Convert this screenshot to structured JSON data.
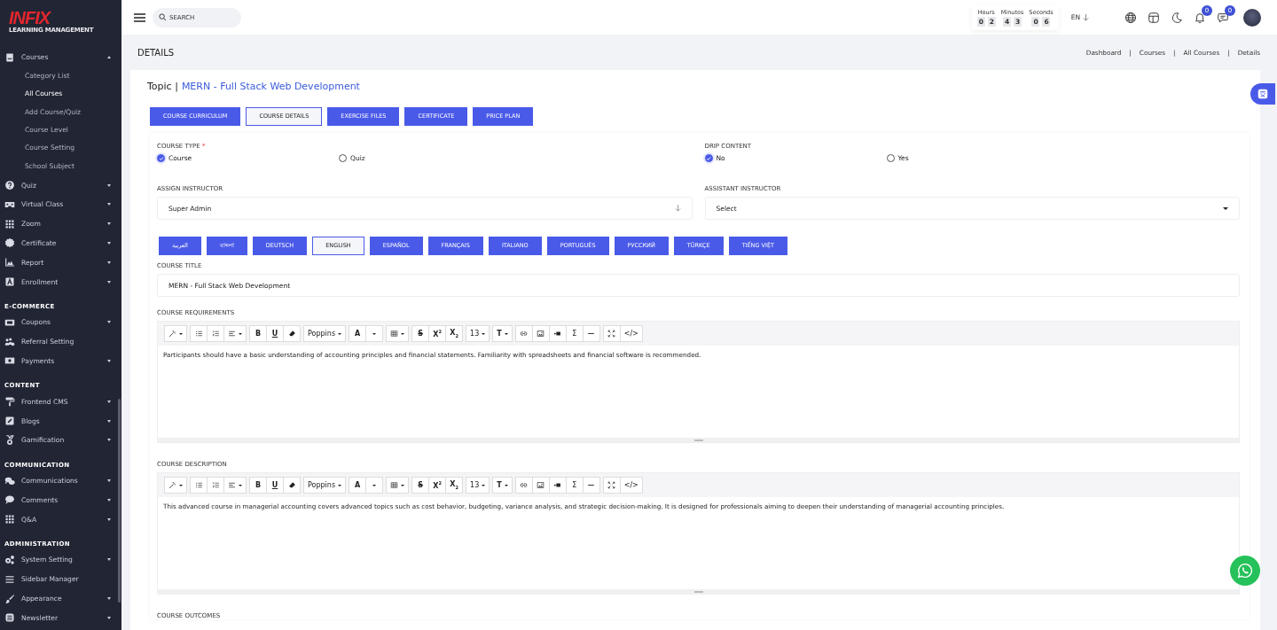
{
  "sidebar": {
    "logo": {
      "title": "INFIX",
      "subtitle": "LEARNING MANAGEMENT"
    },
    "sections": [
      {
        "items": [
          {
            "label": "Courses",
            "kind": "book",
            "expanded": true,
            "children": [
              {
                "label": "Category List",
                "selected": false
              },
              {
                "label": "All Courses",
                "selected": true
              },
              {
                "label": "Add Course/Quiz",
                "selected": false
              },
              {
                "label": "Course Level",
                "selected": false
              },
              {
                "label": "Course Setting",
                "selected": false
              },
              {
                "label": "School Subject",
                "selected": false
              }
            ]
          },
          {
            "label": "Quiz",
            "kind": "question",
            "expanded": false
          },
          {
            "label": "Virtual Class",
            "kind": "vr",
            "expanded": false
          },
          {
            "label": "Zoom",
            "kind": "grid",
            "expanded": false
          },
          {
            "label": "Certificate",
            "kind": "seal",
            "expanded": false
          },
          {
            "label": "Report",
            "kind": "chart",
            "expanded": false
          },
          {
            "label": "Enrollment",
            "kind": "letter",
            "expanded": false
          }
        ]
      },
      {
        "heading": "E-COMMERCE",
        "items": [
          {
            "label": "Coupons",
            "kind": "ticket",
            "expanded": false
          },
          {
            "label": "Referral Setting",
            "kind": "people"
          },
          {
            "label": "Payments",
            "kind": "money",
            "expanded": false
          }
        ]
      },
      {
        "heading": "CONTENT",
        "items": [
          {
            "label": "Frontend CMS",
            "kind": "roller",
            "expanded": false
          },
          {
            "label": "Blogs",
            "kind": "pencil",
            "expanded": false
          },
          {
            "label": "Gamification",
            "kind": "medal",
            "expanded": false
          }
        ]
      },
      {
        "heading": "COMMUNICATION",
        "items": [
          {
            "label": "Communications",
            "kind": "chats",
            "expanded": false
          },
          {
            "label": "Comments",
            "kind": "bubble",
            "expanded": false
          },
          {
            "label": "Q&A",
            "kind": "grid",
            "expanded": false
          }
        ]
      },
      {
        "heading": "ADMINISTRATION",
        "items": [
          {
            "label": "System Setting",
            "kind": "gears",
            "expanded": false
          },
          {
            "label": "Sidebar Manager",
            "kind": "lines"
          },
          {
            "label": "Appearance",
            "kind": "brush",
            "expanded": false
          },
          {
            "label": "Newsletter",
            "kind": "news",
            "expanded": false
          }
        ]
      }
    ]
  },
  "topbar": {
    "search": {
      "placeholder": "SEARCH"
    },
    "timer": [
      {
        "label": "Hours",
        "digits": [
          "0",
          "2"
        ]
      },
      {
        "label": "Minutes",
        "digits": [
          "4",
          "3"
        ]
      },
      {
        "label": "Seconds",
        "digits": [
          "0",
          "6"
        ]
      }
    ],
    "language": "EN",
    "icons": [
      {
        "kind": "globe"
      },
      {
        "kind": "layout"
      },
      {
        "kind": "moon"
      },
      {
        "kind": "bell",
        "badge": "0"
      },
      {
        "kind": "chat",
        "badge": "0"
      }
    ]
  },
  "header": {
    "title": "DETAILS",
    "separator": "|",
    "breadcrumbs": [
      "Dashboard",
      "Courses",
      "All Courses",
      "Details"
    ]
  },
  "topic": {
    "label": "Topic |",
    "value": "MERN - Full Stack Web Development"
  },
  "tabs": [
    {
      "label": "COURSE CURRICULUM",
      "selected": false
    },
    {
      "label": "COURSE DETAILS",
      "selected": true
    },
    {
      "label": "EXERCISE FILES",
      "selected": false
    },
    {
      "label": "CERTIFICATE",
      "selected": false
    },
    {
      "label": "PRICE PLAN",
      "selected": false
    }
  ],
  "form": {
    "course_type": {
      "label": "COURSE TYPE",
      "required_mark": "*",
      "options": [
        {
          "label": "Course",
          "selected": true
        },
        {
          "label": "Quiz",
          "selected": false
        }
      ]
    },
    "drip_content": {
      "label": "DRIP CONTENT",
      "options": [
        {
          "label": "No",
          "selected": true
        },
        {
          "label": "Yes",
          "selected": false
        }
      ]
    },
    "assign_instructor": {
      "label": "ASSIGN INSTRUCTOR",
      "value": "Super Admin"
    },
    "assistant_instructor": {
      "label": "ASSISTANT INSTRUCTOR",
      "value": "Select"
    },
    "languages": [
      {
        "label": "العربية",
        "selected": false
      },
      {
        "label": "বাংলা",
        "selected": false
      },
      {
        "label": "DEUTSCH",
        "selected": false
      },
      {
        "label": "ENGLISH",
        "selected": true
      },
      {
        "label": "ESPAÑOL",
        "selected": false
      },
      {
        "label": "FRANÇAIS",
        "selected": false
      },
      {
        "label": "ITALIANO",
        "selected": false
      },
      {
        "label": "PORTUGUÊS",
        "selected": false
      },
      {
        "label": "РУССКИЙ",
        "selected": false
      },
      {
        "label": "TÜRKÇE",
        "selected": false
      },
      {
        "label": "TIẾNG VIỆT",
        "selected": false
      }
    ],
    "course_title": {
      "label": "COURSE TITLE",
      "value": "MERN - Full Stack Web Development"
    },
    "editors": [
      {
        "label": "COURSE REQUIREMENTS",
        "content": "Participants should have a basic understanding of accounting principles and financial statements. Familiarity with spreadsheets and financial software is recommended.",
        "toolbar": [
          [
            {
              "kind": "magic",
              "dropdown": true
            }
          ],
          [
            {
              "kind": "ul"
            },
            {
              "kind": "ol"
            },
            {
              "kind": "align",
              "dropdown": true
            }
          ],
          [
            {
              "kind": "bold",
              "label": "B"
            },
            {
              "kind": "underline",
              "label": "U"
            },
            {
              "kind": "eraser"
            }
          ],
          [
            {
              "kind": "text",
              "label": "Poppins",
              "dropdown": true
            }
          ],
          [
            {
              "kind": "serif",
              "label": "A"
            },
            {
              "kind": "caret",
              "dropdown": true
            }
          ],
          [
            {
              "kind": "table",
              "dropdown": true
            }
          ],
          [
            {
              "kind": "strike",
              "label": "S"
            },
            {
              "kind": "bold",
              "label": "X$^{2}$"
            },
            {
              "kind": "bold",
              "label": "X$_{2}$"
            }
          ],
          [
            {
              "kind": "text",
              "label": "13",
              "dropdown": true
            }
          ],
          [
            {
              "kind": "serif",
              "label": "T",
              "dropdown": true
            }
          ],
          [
            {
              "kind": "link"
            },
            {
              "kind": "image"
            },
            {
              "kind": "video"
            },
            {
              "kind": "text",
              "label": "Σ"
            },
            {
              "kind": "hr"
            }
          ],
          [
            {
              "kind": "expand"
            },
            {
              "kind": "text",
              "label": "</>"
            }
          ]
        ]
      },
      {
        "label": "COURSE DESCRIPTION",
        "content": "This advanced course in managerial accounting covers advanced topics such as cost behavior, budgeting, variance analysis, and strategic decision-making. It is designed for professionals aiming to deepen their understanding of managerial accounting principles.",
        "toolbar": [
          [
            {
              "kind": "magic",
              "dropdown": true
            }
          ],
          [
            {
              "kind": "ul"
            },
            {
              "kind": "ol"
            },
            {
              "kind": "align",
              "dropdown": true
            }
          ],
          [
            {
              "kind": "bold",
              "label": "B"
            },
            {
              "kind": "underline",
              "label": "U"
            },
            {
              "kind": "eraser"
            }
          ],
          [
            {
              "kind": "text",
              "label": "Poppins",
              "dropdown": true
            }
          ],
          [
            {
              "kind": "serif",
              "label": "A"
            },
            {
              "kind": "caret",
              "dropdown": true
            }
          ],
          [
            {
              "kind": "table",
              "dropdown": true
            }
          ],
          [
            {
              "kind": "strike",
              "label": "S"
            },
            {
              "kind": "bold",
              "label": "X$^{2}$"
            },
            {
              "kind": "bold",
              "label": "X$_{2}$"
            }
          ],
          [
            {
              "kind": "text",
              "label": "13",
              "dropdown": true
            }
          ],
          [
            {
              "kind": "serif",
              "label": "T",
              "dropdown": true
            }
          ],
          [
            {
              "kind": "link"
            },
            {
              "kind": "image"
            },
            {
              "kind": "video"
            },
            {
              "kind": "text",
              "label": "Σ"
            },
            {
              "kind": "hr"
            }
          ],
          [
            {
              "kind": "expand"
            },
            {
              "kind": "text",
              "label": "</>"
            }
          ]
        ]
      }
    ],
    "course_outcomes": {
      "label": "COURSE OUTCOMES"
    }
  }
}
